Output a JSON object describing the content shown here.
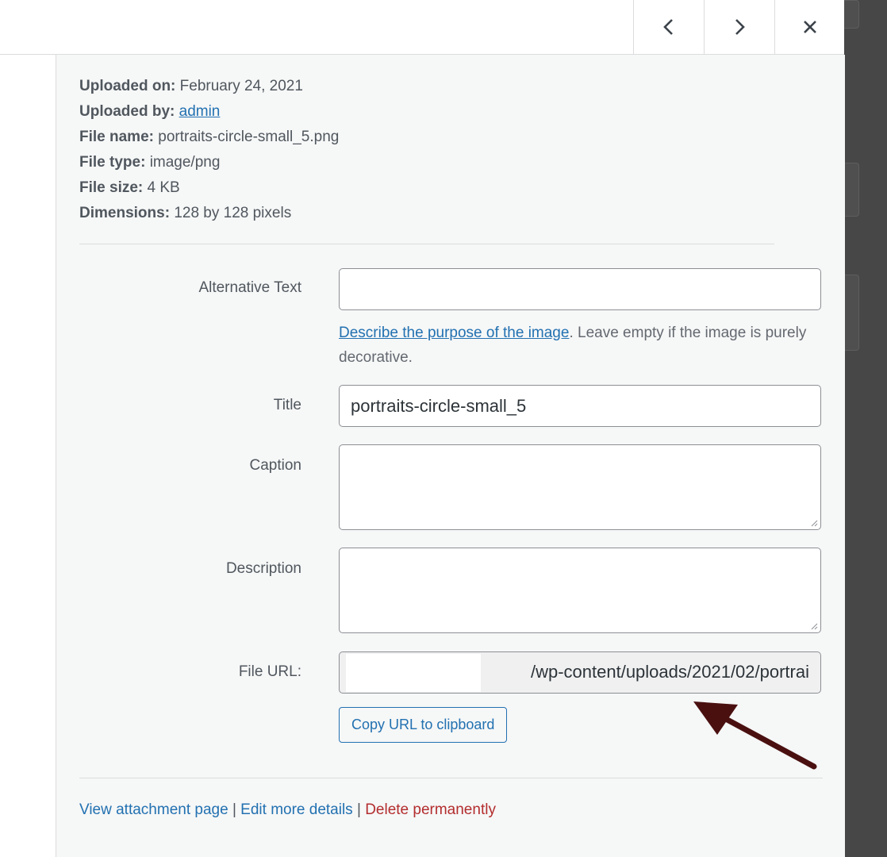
{
  "header": {
    "prev_icon": "chevron-left-icon",
    "next_icon": "chevron-right-icon",
    "close_icon": "close-icon"
  },
  "meta": {
    "uploaded_on_label": "Uploaded on:",
    "uploaded_on_value": "February 24, 2021",
    "uploaded_by_label": "Uploaded by:",
    "uploaded_by_value": "admin",
    "file_name_label": "File name:",
    "file_name_value": "portraits-circle-small_5.png",
    "file_type_label": "File type:",
    "file_type_value": "image/png",
    "file_size_label": "File size:",
    "file_size_value": "4 KB",
    "dimensions_label": "Dimensions:",
    "dimensions_value": "128 by 128 pixels"
  },
  "form": {
    "alt_label": "Alternative Text",
    "alt_value": "",
    "alt_help_link": "Describe the purpose of the image",
    "alt_help_text": ". Leave empty if the image is purely decorative.",
    "title_label": "Title",
    "title_value": "portraits-circle-small_5",
    "caption_label": "Caption",
    "caption_value": "",
    "description_label": "Description",
    "description_value": "",
    "file_url_label": "File URL:",
    "file_url_value": "/wp-content/uploads/2021/02/portrai",
    "copy_button": "Copy URL to clipboard"
  },
  "actions": {
    "view_attachment": "View attachment page",
    "separator": "|",
    "edit_details": "Edit more details",
    "delete": "Delete permanently"
  },
  "colors": {
    "link": "#2271b1",
    "danger": "#b32d2e",
    "arrow": "#4a1010"
  }
}
